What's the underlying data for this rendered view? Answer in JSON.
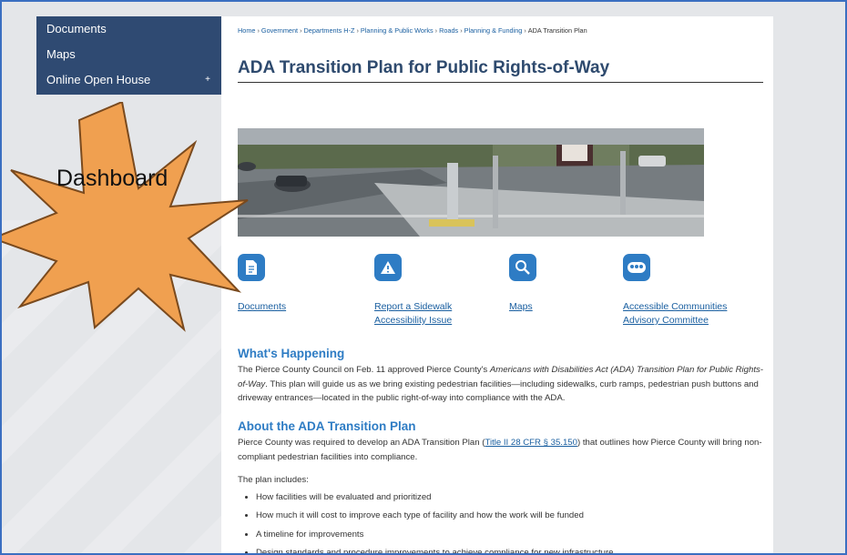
{
  "side_menu": {
    "items": [
      {
        "label": "Documents"
      },
      {
        "label": "Maps"
      },
      {
        "label": "Online Open House",
        "expander": "+"
      }
    ]
  },
  "breadcrumb": {
    "items": [
      "Home",
      "Government",
      "Departments H-Z",
      "Planning & Public Works",
      "Roads",
      "Planning & Funding"
    ],
    "current": "ADA Transition Plan",
    "separator": "›"
  },
  "page_title": "ADA Transition Plan for Public Rights-of-Way",
  "tiles": [
    {
      "icon": "document-icon",
      "line1": "Documents",
      "line2": ""
    },
    {
      "icon": "warning-icon",
      "line1": "Report a Sidewalk",
      "line2": "Accessibility Issue"
    },
    {
      "icon": "magnifier-icon",
      "line1": "Maps",
      "line2": ""
    },
    {
      "icon": "people-icon",
      "line1": "Accessible Communities",
      "line2": "Advisory Committee"
    }
  ],
  "whats_happening": {
    "heading": "What's Happening",
    "p1_a": "The Pierce County Council on Feb. 11 approved Pierce County's ",
    "p1_italic": "Americans with Disabilities Act (ADA) Transition Plan for Public Rights-of-Way",
    "p1_b": ". This plan will guide us as we bring existing pedestrian facilities—including sidewalks, curb ramps, pedestrian push buttons and driveway entrances—located in the public right-of-way into compliance with the ADA."
  },
  "about": {
    "heading": "About the ADA Transition Plan",
    "p1_a": "Pierce County was required to develop an ADA Transition Plan (",
    "p1_link": "Title II 28 CFR § 35.150",
    "p1_b": ") that outlines how Pierce County will bring non-compliant pedestrian facilities into compliance.",
    "intro": "The plan includes:",
    "bullets": [
      "How facilities will be evaluated and prioritized",
      "How much it will cost to improve each type of facility and how the work will be funded",
      "A timeline for improvements",
      "Design standards and procedure improvements to achieve compliance for new infrastructure"
    ]
  },
  "overlay": {
    "label": "Dashboard",
    "fill": "#f0a050",
    "stroke": "#7a4a1e"
  },
  "colors": {
    "nav_bg": "#2f4a72",
    "title": "#2e4a6e",
    "heading": "#2e7cc4",
    "link": "#1a5fa0",
    "border": "#3b6fc1"
  }
}
